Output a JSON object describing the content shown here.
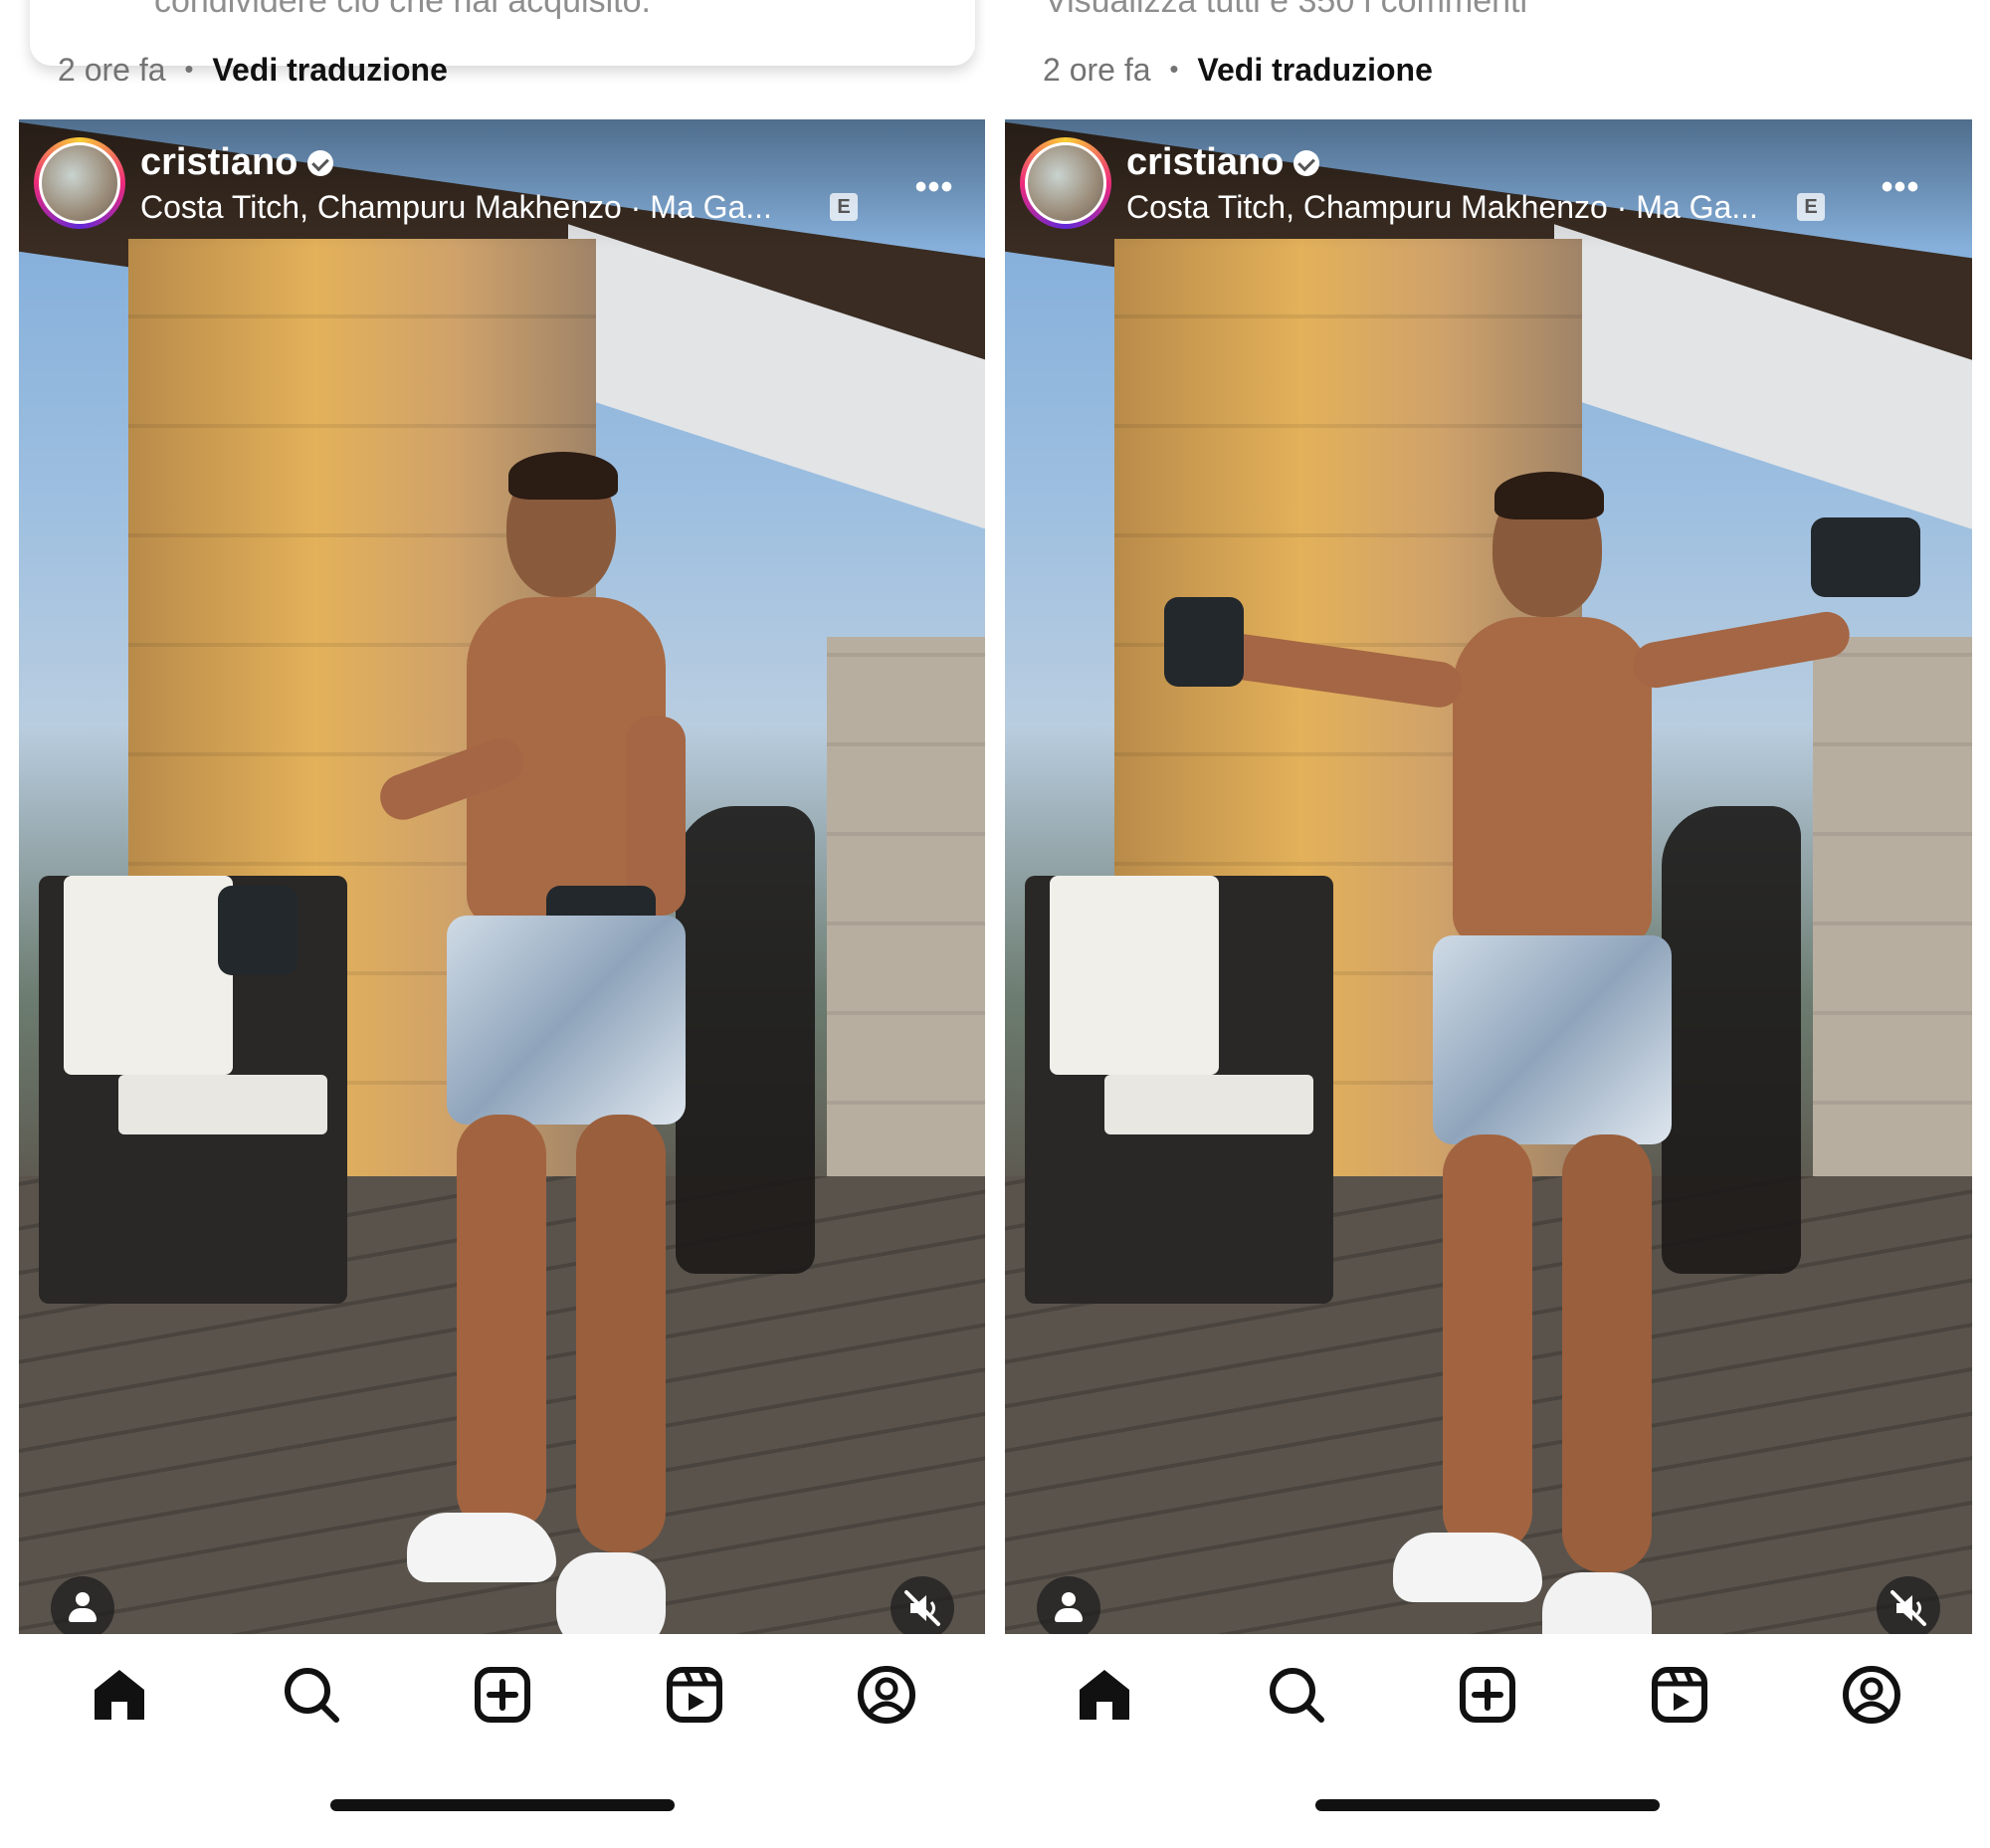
{
  "panels": [
    {
      "cut_text": "condividere ciò che hai acquisito.",
      "time_ago": "2 ore fa",
      "separator": "•",
      "translate_label": "Vedi traduzione",
      "post": {
        "username": "cristiano",
        "verified": true,
        "music": "Costa Titch, Champuru Makhenzo · Ma Ga...",
        "explicit_badge": "E",
        "more_label": "•••"
      }
    },
    {
      "cut_text": "Visualizza tutti e 350 i commenti",
      "time_ago": "2 ore fa",
      "separator": "•",
      "translate_label": "Vedi traduzione",
      "post": {
        "username": "cristiano",
        "verified": true,
        "music": "Costa Titch, Champuru Makhenzo · Ma Ga...",
        "explicit_badge": "E",
        "more_label": "•••"
      }
    }
  ],
  "nav": {
    "items": [
      "home-icon",
      "search-icon",
      "create-icon",
      "reels-icon",
      "profile-icon"
    ],
    "active": "home-icon"
  },
  "colors": {
    "accent_gradient": [
      "#f9ce34",
      "#ee2a7b",
      "#6228d7"
    ],
    "text_muted": "#737373",
    "text_primary": "#111111"
  }
}
